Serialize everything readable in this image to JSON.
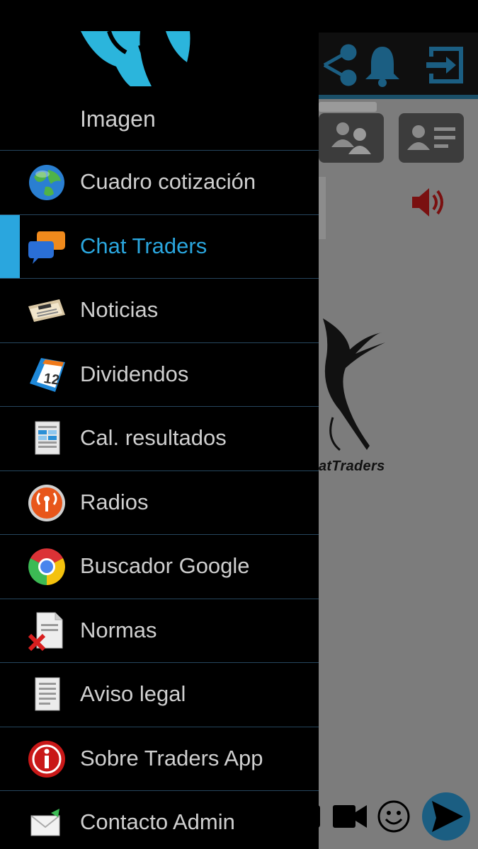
{
  "drawer": {
    "header_label": "Imagen",
    "items": [
      {
        "label": "Cuadro cotización",
        "icon": "globe-icon",
        "active": false
      },
      {
        "label": "Chat Traders",
        "icon": "chat-bubbles-icon",
        "active": true
      },
      {
        "label": "Noticias",
        "icon": "newspaper-icon",
        "active": false
      },
      {
        "label": "Dividendos",
        "icon": "calendar-icon",
        "active": false
      },
      {
        "label": "Cal. resultados",
        "icon": "document-icon",
        "active": false
      },
      {
        "label": "Radios",
        "icon": "radio-icon",
        "active": false
      },
      {
        "label": "Buscador Google",
        "icon": "chrome-icon",
        "active": false
      },
      {
        "label": "Normas",
        "icon": "document-x-icon",
        "active": false
      },
      {
        "label": "Aviso legal",
        "icon": "document-icon",
        "active": false
      },
      {
        "label": "Sobre Traders App",
        "icon": "info-icon",
        "active": false
      },
      {
        "label": "Contacto Admin",
        "icon": "envelope-icon",
        "active": false
      }
    ],
    "calendar_number": "12"
  },
  "app": {
    "logo_text": "atTraders",
    "toolbar_icons": [
      "share-icon",
      "bell-icon",
      "logout-icon"
    ],
    "bottom_icons": [
      "video-camera-icon",
      "emoji-icon",
      "send-icon"
    ]
  },
  "colors": {
    "accent": "#2aa6de",
    "drawer_bg": "#000000",
    "divider": "#26465e",
    "content_dim": "#7c7c7c"
  }
}
